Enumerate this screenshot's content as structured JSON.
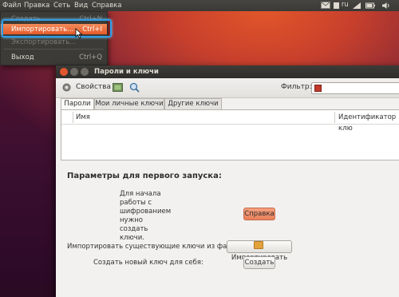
{
  "topbar": {
    "menus": [
      "Файл",
      "Правка",
      "Сеть",
      "Вид",
      "Справка"
    ],
    "tray_keyboard": "ru"
  },
  "file_menu": {
    "items": [
      {
        "label": "Создать...",
        "shortcut": "Ctrl+N",
        "state": "disabled"
      },
      {
        "label": "Импортировать...",
        "shortcut": "Ctrl+I",
        "state": "active"
      },
      {
        "label": "Экспортировать...",
        "shortcut": "",
        "state": "disabled"
      },
      {
        "label": "Выход",
        "shortcut": "Ctrl+Q",
        "state": "normal"
      }
    ]
  },
  "window": {
    "title": "Пароли и ключи",
    "toolbar": {
      "properties_label": "Свойства",
      "filter_label": "Фильтр:"
    },
    "tabs": [
      "Пароли",
      "Мои личные ключи",
      "Другие ключи"
    ],
    "active_tab": 0,
    "columns": [
      "Имя",
      "Идентификатор клю"
    ],
    "first_run": {
      "title": "Параметры для первого запуска:",
      "intro_lines": [
        "Для начала",
        "работы с",
        "шифрованием",
        "нужно",
        "создать",
        "ключи."
      ],
      "help_button": "Справка",
      "import_label": "Импортировать существующие ключи из файла:",
      "import_button": "Импортировать",
      "create_label": "Создать новый ключ для себя:",
      "create_button": "Создать"
    }
  },
  "colors": {
    "accent": "#e55a2a",
    "highlight_border": "#2f9ee8",
    "titlebar": "#3c3b37"
  }
}
